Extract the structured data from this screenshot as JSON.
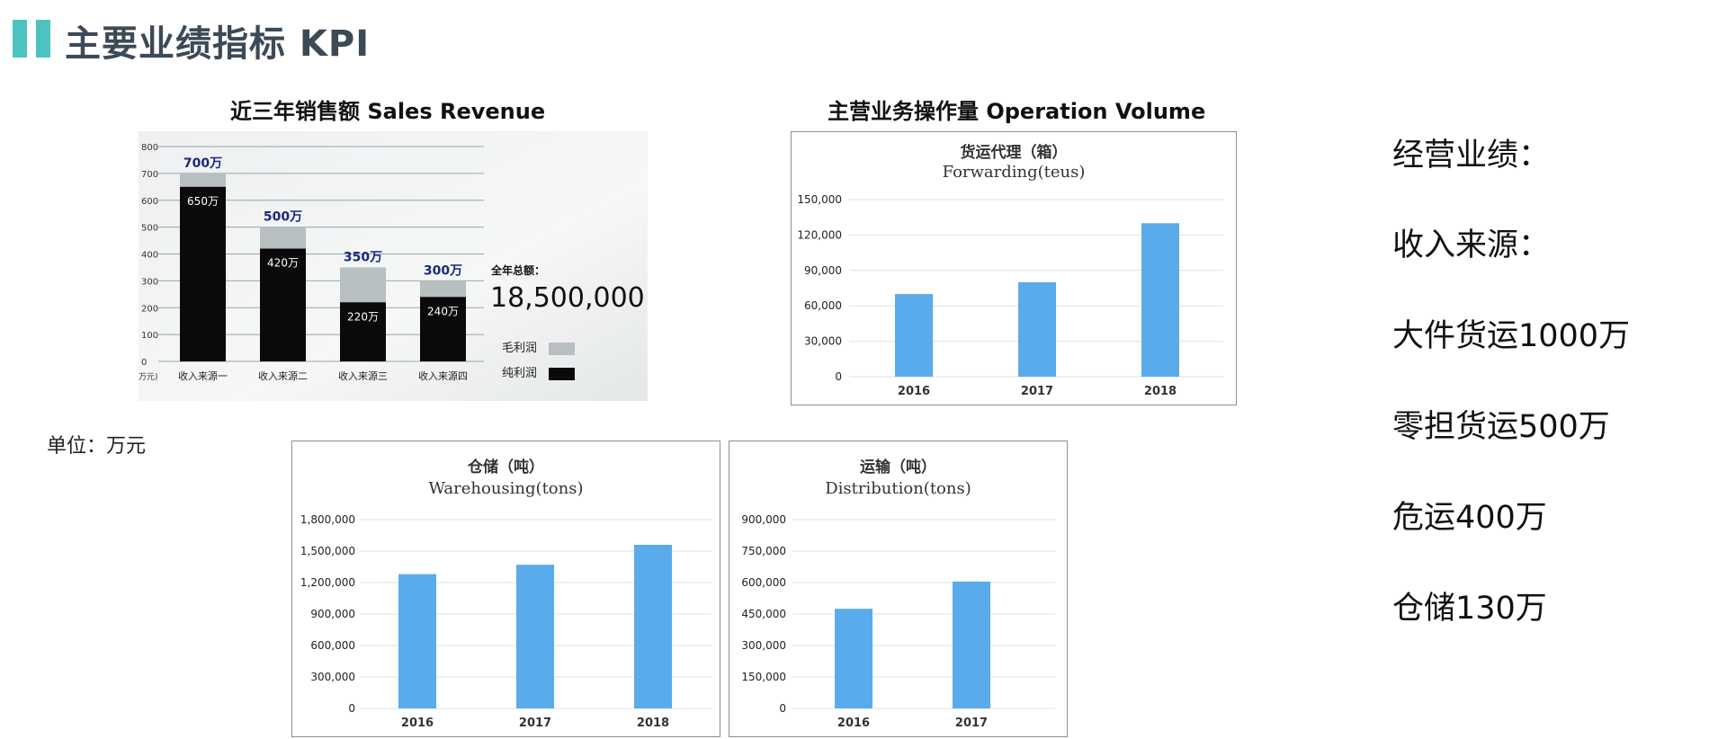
{
  "page": {
    "title": "主要业绩指标 KPI",
    "unit_label": "单位：万元"
  },
  "sales_chart": {
    "heading": "近三年销售额 Sales Revenue"
  },
  "operation_chart": {
    "heading": "主营业务操作量 Operation Volume"
  },
  "right_panel": {
    "lines": [
      "经营业绩：",
      "收入来源：",
      "大件货运1000万",
      "零担货运500万",
      "危运400万",
      "仓储130万"
    ]
  },
  "colors": {
    "accent": "#4cc3c0",
    "title": "#3c4a57",
    "bar_blue": "#59abeb",
    "gross_bar": "#b8bfc1",
    "net_bar": "#0a0a0a",
    "value_label": "#1a2a7a"
  },
  "chart_data": [
    {
      "type": "bar",
      "title": "近三年销售额 Sales Revenue",
      "unit_tick": "万元)",
      "categories": [
        "收入来源一",
        "收入来源二",
        "收入来源三",
        "收入来源四"
      ],
      "ylim": [
        0,
        800
      ],
      "yticks": [
        "0",
        "100",
        "200",
        "300",
        "400",
        "500",
        "600",
        "700",
        "800"
      ],
      "series": [
        {
          "name": "毛利润",
          "values": [
            700,
            500,
            350,
            300
          ],
          "labels": [
            "700万",
            "500万",
            "350万",
            "300万"
          ]
        },
        {
          "name": "纯利润",
          "values": [
            650,
            420,
            220,
            240
          ],
          "labels": [
            "650万",
            "420万",
            "220万",
            "240万"
          ]
        }
      ],
      "total_label": "全年总额：",
      "total_value": "18,500,000",
      "legend": "right",
      "grid": true
    },
    {
      "type": "bar",
      "title": "货运代理（箱）",
      "subtitle": "Forwarding(teus)",
      "categories": [
        "2016",
        "2017",
        "2018"
      ],
      "values": [
        70000,
        80000,
        130000
      ],
      "ylim": [
        0,
        150000
      ],
      "yticks": [
        "0",
        "30,000",
        "60,000",
        "90,000",
        "120,000",
        "150,000"
      ],
      "grid": true
    },
    {
      "type": "bar",
      "title": "仓储（吨）",
      "subtitle": "Warehousing(tons)",
      "categories": [
        "2016",
        "2017",
        "2018"
      ],
      "values": [
        1280000,
        1370000,
        1560000
      ],
      "ylim": [
        0,
        1800000
      ],
      "yticks": [
        "0",
        "300,000",
        "600,000",
        "900,000",
        "1,200,000",
        "1,500,000",
        "1,800,000"
      ],
      "grid": true
    },
    {
      "type": "bar",
      "title": "运输（吨）",
      "subtitle": "Distribution(tons)",
      "categories": [
        "2016",
        "2017"
      ],
      "values": [
        475000,
        605000
      ],
      "ylim": [
        0,
        900000
      ],
      "yticks": [
        "0",
        "150,000",
        "300,000",
        "450,000",
        "600,000",
        "750,000",
        "900,000"
      ],
      "grid": true
    }
  ]
}
